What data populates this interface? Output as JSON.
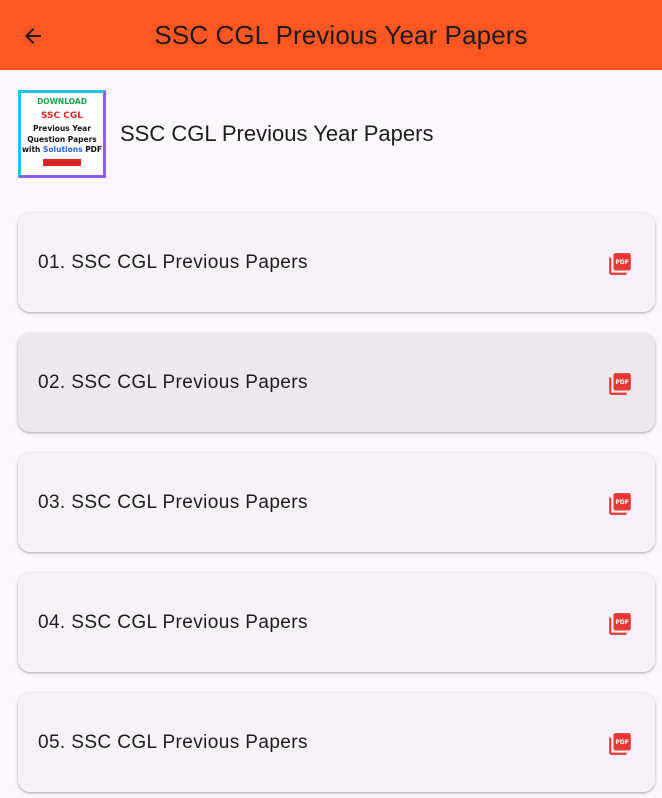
{
  "appbar": {
    "title": "SSC CGL Previous Year Papers",
    "back_icon": "arrow-back-icon",
    "color": "#ff5722"
  },
  "header": {
    "thumbnail": {
      "line1": "DOWNLOAD",
      "line2": "SSC CGL",
      "line3": "Previous Year",
      "line4": "Question Papers",
      "line5_prefix": "with ",
      "line5_highlight": "Solutions",
      "line5_suffix": " PDF"
    },
    "title": "SSC CGL Previous Year Papers"
  },
  "items": [
    {
      "label": "01. SSC CGL Previous Papers",
      "icon": "pdf-icon"
    },
    {
      "label": "02. SSC CGL Previous Papers",
      "icon": "pdf-icon"
    },
    {
      "label": "03. SSC CGL Previous Papers",
      "icon": "pdf-icon"
    },
    {
      "label": "04. SSC CGL Previous Papers",
      "icon": "pdf-icon"
    },
    {
      "label": "05. SSC CGL Previous Papers",
      "icon": "pdf-icon"
    }
  ],
  "colors": {
    "accent": "#ff5722",
    "pdf_red": "#e53935",
    "card": "#f7f0f8",
    "background": "#fdf7fd"
  }
}
